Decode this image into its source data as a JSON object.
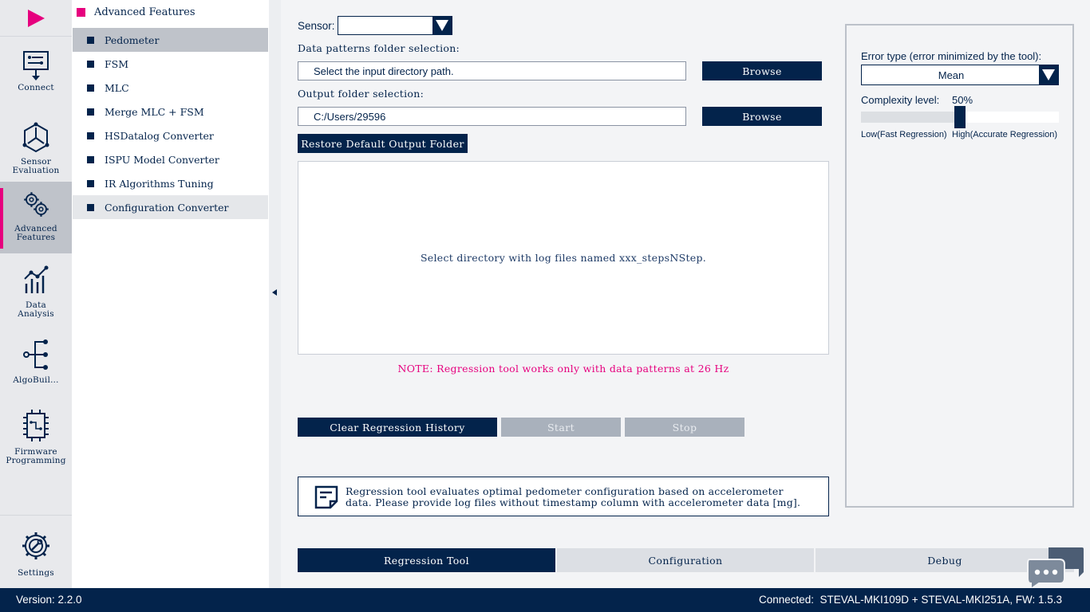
{
  "rail": {
    "items": [
      {
        "label": "Connect"
      },
      {
        "label_line1": "Sensor",
        "label_line2": "Evaluation"
      },
      {
        "label_line1": "Advanced",
        "label_line2": "Features"
      },
      {
        "label_line1": "Data",
        "label_line2": "Analysis"
      },
      {
        "label": "AlgoBuil…"
      },
      {
        "label_line1": "Firmware",
        "label_line2": "Programming"
      },
      {
        "label": "Settings"
      }
    ],
    "active_index": 2
  },
  "submenu": {
    "title": "Advanced Features",
    "items": [
      {
        "label": "Pedometer"
      },
      {
        "label": "FSM"
      },
      {
        "label": "MLC"
      },
      {
        "label": "Merge MLC + FSM"
      },
      {
        "label": "HSDatalog Converter"
      },
      {
        "label": "ISPU Model Converter"
      },
      {
        "label": "IR Algorithms Tuning"
      },
      {
        "label": "Configuration Converter"
      }
    ]
  },
  "main": {
    "sensor_label": "Sensor:",
    "sensor_value": "",
    "data_patterns_label": "Data patterns folder selection:",
    "data_patterns_value": "Select the input directory path.",
    "output_label": "Output folder selection:",
    "output_value": "C:/Users/29596",
    "browse_label": "Browse",
    "restore_label": "Restore Default Output Folder",
    "drop_hint": "Select directory with log files named xxx_stepsNStep.",
    "note": "NOTE: Regression tool works only with data patterns at 26 Hz",
    "clear_label": "Clear Regression History",
    "start_label": "Start",
    "stop_label": "Stop",
    "info_line1": "Regression tool evaluates optimal pedometer configuration based on accelerometer",
    "info_line2": "data. Please provide log files without timestamp column with accelerometer data [mg]."
  },
  "options": {
    "error_type_label": "Error type (error minimized by the tool):",
    "error_type_value": "Mean",
    "complexity_label": "Complexity level:",
    "complexity_value": "50%",
    "complexity_fraction": 0.5,
    "low_label": "Low(Fast Regression)",
    "high_label": "High(Accurate Regression)"
  },
  "tabs": [
    {
      "label": "Regression Tool",
      "active": true
    },
    {
      "label": "Configuration",
      "active": false
    },
    {
      "label": "Debug",
      "active": false
    }
  ],
  "status": {
    "version": "Version: 2.2.0",
    "connected": "Connected:  STEVAL-MKI109D + STEVAL-MKI251A, FW: 1.5.3"
  },
  "colors": {
    "navy": "#03234b",
    "accent_pink": "#e6007e",
    "disabled": "#a9b1bc"
  }
}
